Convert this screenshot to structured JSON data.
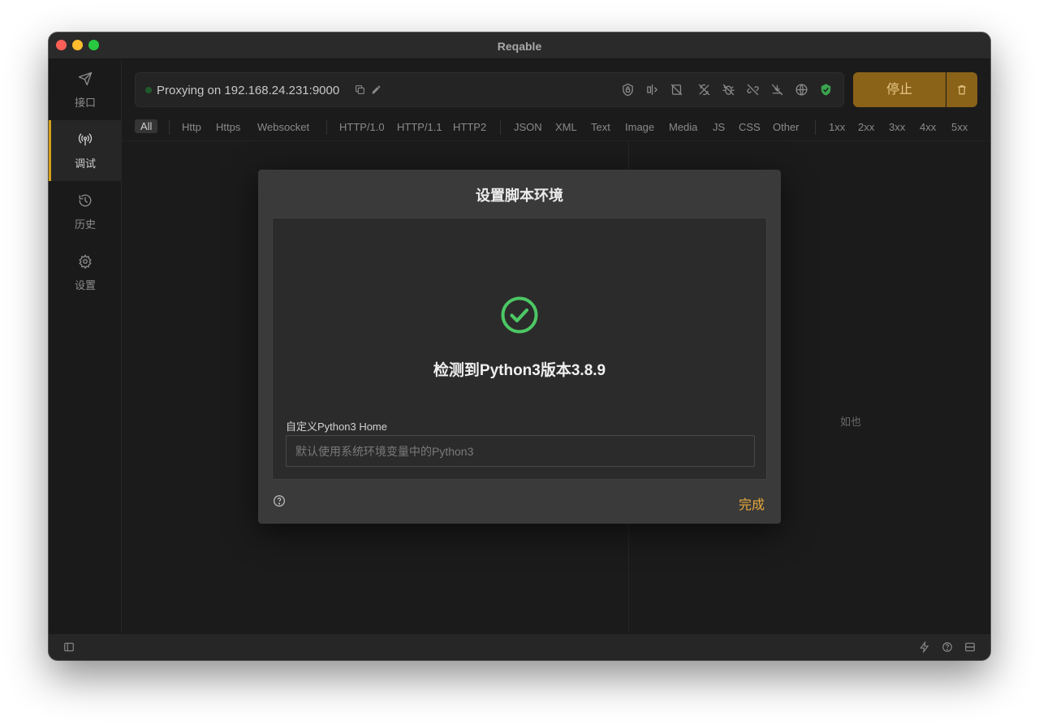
{
  "window": {
    "title": "Reqable"
  },
  "sidebar": {
    "items": [
      {
        "label": "接口",
        "icon": "send-icon"
      },
      {
        "label": "调试",
        "icon": "antenna-icon",
        "active": true
      },
      {
        "label": "历史",
        "icon": "history-icon"
      },
      {
        "label": "设置",
        "icon": "gear-icon"
      }
    ]
  },
  "proxy": {
    "status_text": "Proxying on 192.168.24.231:9000",
    "stop_label": "停止"
  },
  "filters": {
    "all": "All",
    "protocols": [
      "Http",
      "Https",
      "Websocket"
    ],
    "versions": [
      "HTTP/1.0",
      "HTTP/1.1",
      "HTTP2"
    ],
    "types": [
      "JSON",
      "XML",
      "Text",
      "Image",
      "Media",
      "JS",
      "CSS",
      "Other"
    ],
    "status": [
      "1xx",
      "2xx",
      "3xx",
      "4xx",
      "5xx"
    ]
  },
  "background": {
    "partial_text": "如也"
  },
  "dialog": {
    "title": "设置脚本环境",
    "detected_text": "检测到Python3版本3.8.9",
    "field_label": "自定义Python3 Home",
    "field_placeholder": "默认使用系统环境变量中的Python3",
    "field_value": "",
    "done_label": "完成"
  },
  "colors": {
    "accent": "#e8a93a",
    "success": "#4cc764",
    "stop_button": "#8a6218"
  }
}
